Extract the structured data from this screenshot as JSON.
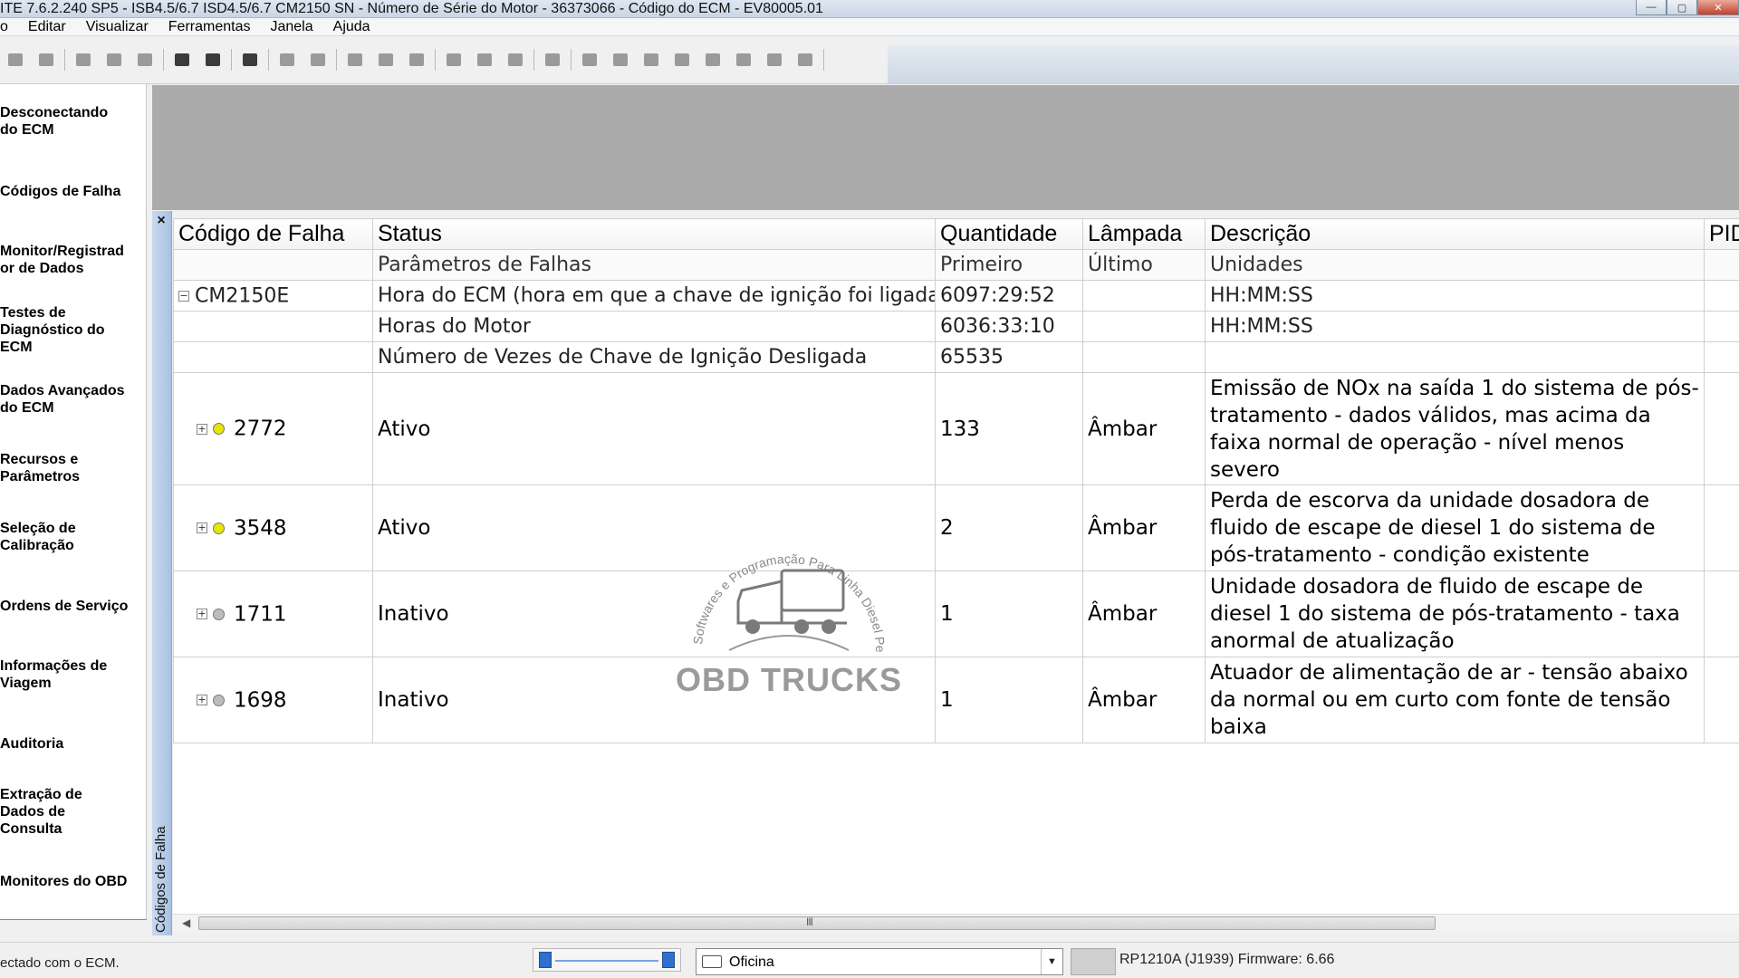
{
  "window": {
    "title": "ITE 7.6.2.240 SP5 - ISB4.5/6.7 ISD4.5/6.7 CM2150 SN - Número de Série do Motor - 36373066 - Código do ECM - EV80005.01"
  },
  "menu": [
    "o",
    "Editar",
    "Visualizar",
    "Ferramentas",
    "Janela",
    "Ajuda"
  ],
  "toolbar": {
    "icons": [
      "connect-icon",
      "disconnect-icon",
      "cut-icon",
      "copy-icon",
      "paste-icon",
      "print-icon",
      "print-preview-icon",
      "find-icon",
      "refresh-icon",
      "tools-icon",
      "back-icon",
      "ecm-data-icon",
      "save-icon",
      "report-icon",
      "export-icon",
      "filter-icon",
      "page-icon",
      "record-icon",
      "monitor-icon",
      "play-icon",
      "pause-icon",
      "stop-icon",
      "clear-icon",
      "snapshot-icon",
      "edit-icon"
    ]
  },
  "sidebar": {
    "items": [
      {
        "label": "Desconectando\ndo ECM"
      },
      {
        "label": "Códigos de Falha"
      },
      {
        "label": "Monitor/Registrad\nor de Dados"
      },
      {
        "label": "Testes de\nDiagnóstico do\nECM"
      },
      {
        "label": "Dados Avançados\ndo ECM"
      },
      {
        "label": "Recursos e\nParâmetros"
      },
      {
        "label": "Seleção de\nCalibração"
      },
      {
        "label": "Ordens de Serviço"
      },
      {
        "label": "Informações de\nViagem"
      },
      {
        "label": "Auditoria"
      },
      {
        "label": "Extração de\nDados de\nConsulta"
      },
      {
        "label": "Monitores do OBD"
      }
    ]
  },
  "panel": {
    "vertical_tab_label": "Códigos de Falha",
    "close_glyph": "×"
  },
  "grid": {
    "headers": [
      "Código de Falha",
      "Status",
      "Quantidade",
      "Lâmpada",
      "Descrição",
      "PID"
    ],
    "subheaders": [
      "",
      "Parâmetros de Falhas",
      "Primeiro",
      "Último",
      "Unidades",
      ""
    ],
    "ecm_group": {
      "name": "CM2150E",
      "expander": "−",
      "params": [
        {
          "name": "Hora do ECM (hora em que a chave de ignição foi ligada)",
          "first": "6097:29:52",
          "last": "",
          "units": "HH:MM:SS"
        },
        {
          "name": "Horas do Motor",
          "first": "6036:33:10",
          "last": "",
          "units": "HH:MM:SS"
        },
        {
          "name": "Número de Vezes de Chave de Ignição Desligada",
          "first": "65535",
          "last": "",
          "units": ""
        }
      ]
    },
    "faults": [
      {
        "code": "2772",
        "status": "Ativo",
        "count": "133",
        "lamp": "Âmbar",
        "description": "Emissão de NOx na saída 1 do sistema de pós-tratamento - dados válidos, mas acima da faixa normal de operação - nível menos severo",
        "indicator_color": "#e6e600",
        "expander": "+"
      },
      {
        "code": "3548",
        "status": "Ativo",
        "count": "2",
        "lamp": "Âmbar",
        "description": "Perda de escorva da unidade dosadora de fluido de escape de diesel 1 do sistema de pós-tratamento - condição existente",
        "indicator_color": "#e6e600",
        "expander": "+"
      },
      {
        "code": "1711",
        "status": "Inativo",
        "count": "1",
        "lamp": "Âmbar",
        "description": "Unidade dosadora de fluido de escape de diesel 1 do sistema de pós-tratamento - taxa anormal de atualização",
        "indicator_color": "#bdbdbd",
        "expander": "+"
      },
      {
        "code": "1698",
        "status": "Inativo",
        "count": "1",
        "lamp": "Âmbar",
        "description": "Atuador de alimentação de ar - tensão abaixo da normal ou em curto com fonte de tensão baixa",
        "indicator_color": "#bdbdbd",
        "expander": "+"
      }
    ]
  },
  "watermark": {
    "arc_text": "Softwares e Programação Para Linha Diesel Pesado",
    "brand": "OBD TRUCKS"
  },
  "scrollbar": {
    "grip": "III"
  },
  "status": {
    "message": "ectado com o ECM.",
    "location_select": "Oficina",
    "adapter": "RP1210A (J1939)  Firmware: 6.66"
  },
  "colors": {
    "active_indicator": "#e6e600",
    "inactive_indicator": "#bdbdbd",
    "header_gray": "#ababab",
    "vertical_tab": "#b6cbe8"
  }
}
